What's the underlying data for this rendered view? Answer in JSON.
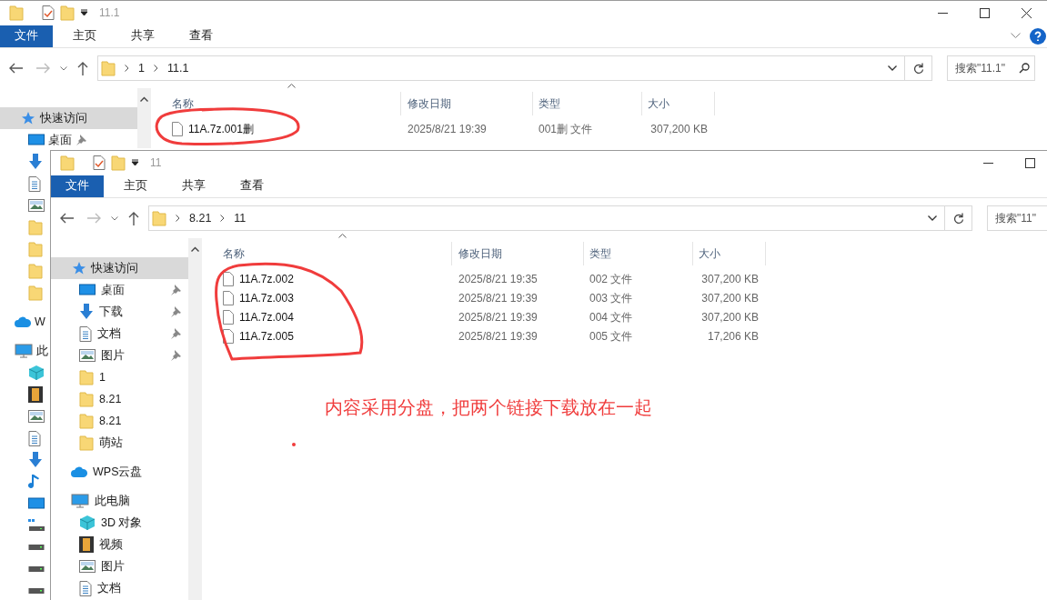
{
  "windows": [
    {
      "title": "11.1",
      "controls": [
        {
          "kind": "minimize"
        },
        {
          "kind": "maximize"
        },
        {
          "kind": "close"
        }
      ],
      "ribbon_buttons": [
        {
          "kind": "expand"
        },
        {
          "kind": "help"
        }
      ],
      "ribbon_tabs": [
        {
          "label": "文件",
          "selected": true
        },
        {
          "label": "主页",
          "selected": false
        },
        {
          "label": "共享",
          "selected": false
        },
        {
          "label": "查看",
          "selected": false
        }
      ],
      "breadcrumb": [
        "1",
        "11.1"
      ],
      "search": {
        "placeholder": "搜索\"11.1\""
      },
      "sidebar": [
        {
          "kind": "star",
          "label": "快速访问",
          "selected": true,
          "children": [
            {
              "kind": "desktop",
              "label": "桌面",
              "pinned": true
            },
            {
              "kind": "download"
            },
            {
              "kind": "doc"
            },
            {
              "kind": "image"
            },
            {
              "kind": "folder"
            },
            {
              "kind": "folder"
            },
            {
              "kind": "folder"
            },
            {
              "kind": "folder"
            }
          ]
        },
        {
          "kind": "cloud",
          "label": "W"
        },
        {
          "kind": "pc",
          "label": "此",
          "children": [
            {
              "kind": "cube"
            },
            {
              "kind": "film"
            },
            {
              "kind": "image"
            },
            {
              "kind": "doc"
            },
            {
              "kind": "download"
            },
            {
              "kind": "music"
            },
            {
              "kind": "desktop"
            },
            {
              "kind": "drive-win"
            },
            {
              "kind": "drive"
            },
            {
              "kind": "drive"
            },
            {
              "kind": "drive"
            }
          ]
        }
      ],
      "columns": [
        "名称",
        "修改日期",
        "类型",
        "大小"
      ],
      "files": [
        {
          "name": "11A.7z.001删",
          "modified": "2025/8/21 19:39",
          "type": "001删 文件",
          "size": "307,200 KB"
        }
      ]
    },
    {
      "title": "11",
      "controls": [
        {
          "kind": "minimize"
        },
        {
          "kind": "maximize"
        }
      ],
      "ribbon_tabs": [
        {
          "label": "文件",
          "selected": true
        },
        {
          "label": "主页",
          "selected": false
        },
        {
          "label": "共享",
          "selected": false
        },
        {
          "label": "查看",
          "selected": false
        }
      ],
      "breadcrumb": [
        "8.21",
        "11"
      ],
      "search": {
        "placeholder": "搜索\"11\""
      },
      "sidebar": [
        {
          "kind": "star",
          "label": "快速访问",
          "selected": true,
          "children": [
            {
              "kind": "desktop",
              "label": "桌面",
              "pinned": true
            },
            {
              "kind": "download",
              "label": "下载",
              "pinned": true
            },
            {
              "kind": "doc",
              "label": "文档",
              "pinned": true
            },
            {
              "kind": "image",
              "label": "图片",
              "pinned": true
            },
            {
              "kind": "folder",
              "label": "1",
              "pinned": false
            },
            {
              "kind": "folder",
              "label": "8.21",
              "pinned": false
            },
            {
              "kind": "folder",
              "label": "8.21",
              "pinned": false
            },
            {
              "kind": "folder",
              "label": "萌站",
              "pinned": false
            }
          ]
        },
        {
          "kind": "cloud",
          "label": "WPS云盘"
        },
        {
          "kind": "pc",
          "label": "此电脑",
          "children": [
            {
              "kind": "cube",
              "label": "3D 对象"
            },
            {
              "kind": "film",
              "label": "视频"
            },
            {
              "kind": "image",
              "label": "图片"
            },
            {
              "kind": "doc",
              "label": "文档"
            }
          ]
        }
      ],
      "columns": [
        "名称",
        "修改日期",
        "类型",
        "大小"
      ],
      "files": [
        {
          "name": "11A.7z.002",
          "modified": "2025/8/21 19:35",
          "type": "002 文件",
          "size": "307,200 KB"
        },
        {
          "name": "11A.7z.003",
          "modified": "2025/8/21 19:39",
          "type": "003 文件",
          "size": "307,200 KB"
        },
        {
          "name": "11A.7z.004",
          "modified": "2025/8/21 19:39",
          "type": "004 文件",
          "size": "307,200 KB"
        },
        {
          "name": "11A.7z.005",
          "modified": "2025/8/21 19:39",
          "type": "005 文件",
          "size": "17,206 KB"
        }
      ]
    }
  ],
  "annotation": {
    "note": "内容采用分盘，把两个链接下载放在一起"
  }
}
